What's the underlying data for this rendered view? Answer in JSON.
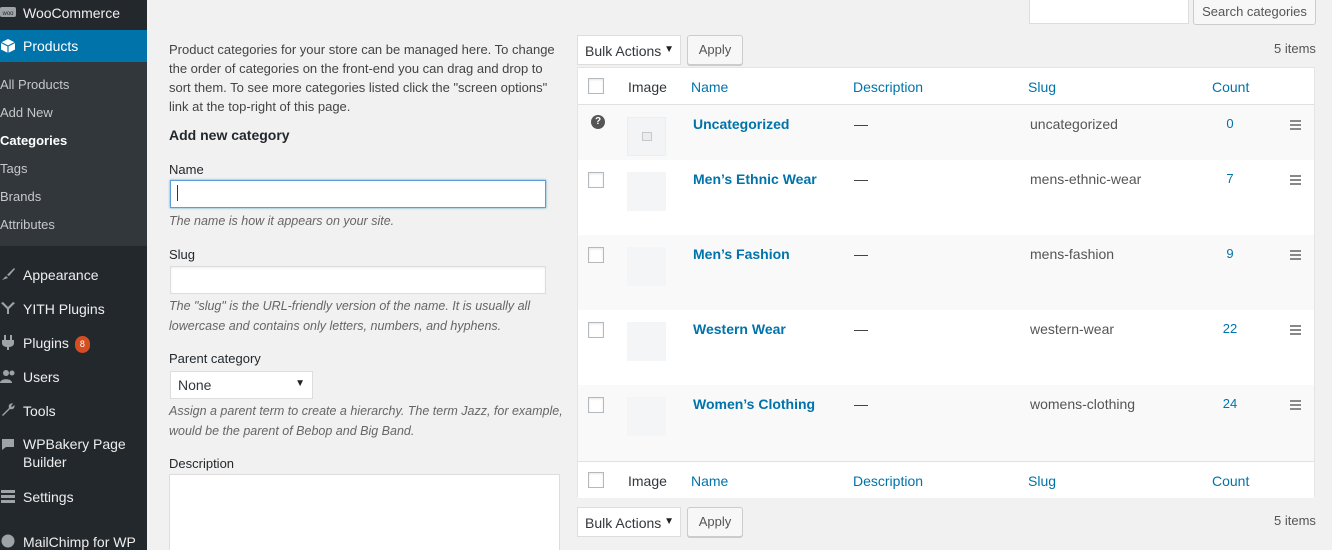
{
  "sidebar": {
    "woocommerce": "WooCommerce",
    "products": "Products",
    "submenu": [
      "All Products",
      "Add New",
      "Categories",
      "Tags",
      "Brands",
      "Attributes"
    ],
    "appearance": "Appearance",
    "yith": "YITH Plugins",
    "plugins": "Plugins",
    "plugins_badge": "8",
    "users": "Users",
    "tools": "Tools",
    "wpbakery_line1": "WPBakery Page",
    "wpbakery_line2": "Builder",
    "settings": "Settings",
    "mailchimp": "MailChimp for WP"
  },
  "search": {
    "button": "Search categories",
    "value": ""
  },
  "form": {
    "intro": "Product categories for your store can be managed here. To change the order of categories on the front-end you can drag and drop to sort them. To see more categories listed click the \"screen options\" link at the top-right of this page.",
    "heading": "Add new category",
    "name_label": "Name",
    "name_value": "",
    "name_desc": "The name is how it appears on your site.",
    "slug_label": "Slug",
    "slug_value": "",
    "slug_desc": "The \"slug\" is the URL-friendly version of the name. It is usually all lowercase and contains only letters, numbers, and hyphens.",
    "parent_label": "Parent category",
    "parent_value": "None",
    "parent_desc": "Assign a parent term to create a hierarchy. The term Jazz, for example, would be the parent of Bebop and Big Band.",
    "description_label": "Description"
  },
  "actions": {
    "bulk_label": "Bulk Actions",
    "apply_label": "Apply",
    "items_count": "5 items"
  },
  "table": {
    "columns": [
      "Image",
      "Name",
      "Description",
      "Slug",
      "Count"
    ],
    "rows": [
      {
        "name": "Uncategorized",
        "description": "—",
        "slug": "uncategorized",
        "count": "0"
      },
      {
        "name": "Men’s Ethnic Wear",
        "description": "—",
        "slug": "mens-ethnic-wear",
        "count": "7"
      },
      {
        "name": "Men’s Fashion",
        "description": "—",
        "slug": "mens-fashion",
        "count": "9"
      },
      {
        "name": "Western Wear",
        "description": "—",
        "slug": "western-wear",
        "count": "22"
      },
      {
        "name": "Women’s Clothing",
        "description": "—",
        "slug": "womens-clothing",
        "count": "24"
      }
    ]
  }
}
